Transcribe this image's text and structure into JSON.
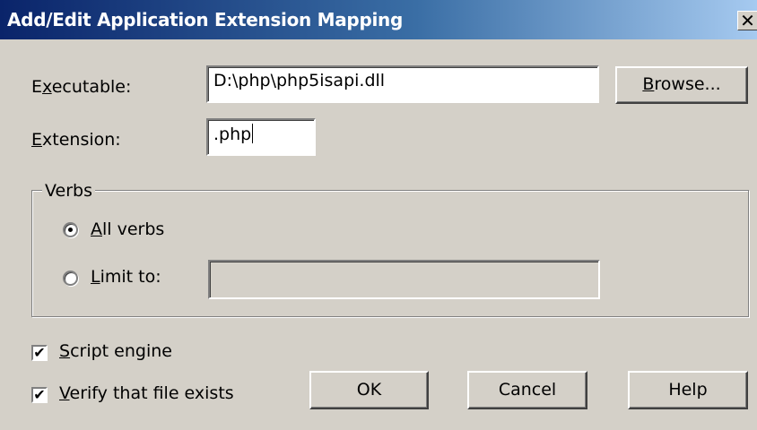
{
  "dialog": {
    "title": "Add/Edit Application Extension Mapping",
    "close_glyph": "✕"
  },
  "executable": {
    "label_access": "x",
    "label_pre": "E",
    "label_post": "ecutable:",
    "value": "D:\\php\\php5isapi.dll",
    "browse_access": "B",
    "browse_rest": "rowse..."
  },
  "extension": {
    "label_access": "E",
    "label_rest": "xtension:",
    "value": ".php"
  },
  "verbs": {
    "group_title": "Verbs",
    "all_verbs_access": "A",
    "all_verbs_rest": "ll verbs",
    "all_verbs_selected": true,
    "limit_to_access": "L",
    "limit_to_rest": "imit to:",
    "limit_to_selected": false,
    "limit_to_value": ""
  },
  "options": {
    "script_engine_access": "S",
    "script_engine_rest": "cript engine",
    "script_engine_checked": true,
    "verify_access": "V",
    "verify_rest": "erify that file exists",
    "verify_checked": true,
    "check_glyph": "✔"
  },
  "buttons": {
    "ok": "OK",
    "cancel": "Cancel",
    "help": "Help"
  }
}
